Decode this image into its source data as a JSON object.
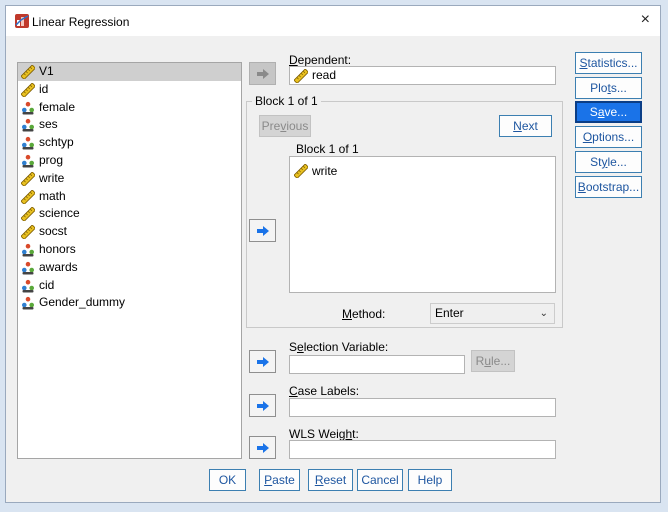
{
  "window": {
    "title": "Linear Regression",
    "close_label": "×"
  },
  "variables": [
    {
      "name": "V1",
      "type": "scale",
      "selected": true
    },
    {
      "name": "id",
      "type": "scale"
    },
    {
      "name": "female",
      "type": "nominal"
    },
    {
      "name": "ses",
      "type": "nominal"
    },
    {
      "name": "schtyp",
      "type": "nominal"
    },
    {
      "name": "prog",
      "type": "nominal"
    },
    {
      "name": "write",
      "type": "scale"
    },
    {
      "name": "math",
      "type": "scale"
    },
    {
      "name": "science",
      "type": "scale"
    },
    {
      "name": "socst",
      "type": "scale"
    },
    {
      "name": "honors",
      "type": "nominal"
    },
    {
      "name": "awards",
      "type": "nominal"
    },
    {
      "name": "cid",
      "type": "nominal"
    },
    {
      "name": "Gender_dummy",
      "type": "nominal"
    }
  ],
  "dependent": {
    "label_u": "D",
    "label_rest": "ependent:",
    "value": "read"
  },
  "block": {
    "legend": "Block 1 of 1",
    "header": "Block 1 of 1",
    "previous_pre": "Pre",
    "previous_u": "v",
    "previous_post": "ious",
    "next_u": "N",
    "next_rest": "ext",
    "independents": [
      "write"
    ],
    "method_u": "M",
    "method_rest": "ethod:",
    "method_value": "Enter"
  },
  "selection": {
    "pre": "S",
    "u": "e",
    "post": "lection Variable:",
    "value": "",
    "rule_pre": "R",
    "rule_u": "u",
    "rule_post": "le..."
  },
  "case_labels": {
    "u": "C",
    "post": "ase Labels:",
    "value": ""
  },
  "wls": {
    "pre": "WLS Weig",
    "u": "h",
    "post": "t:",
    "value": ""
  },
  "side_buttons": [
    {
      "pre": "",
      "u": "S",
      "post": "tatistics..."
    },
    {
      "pre": "Plo",
      "u": "t",
      "post": "s..."
    },
    {
      "pre": "S",
      "u": "a",
      "post": "ve..."
    },
    {
      "pre": "",
      "u": "O",
      "post": "ptions..."
    },
    {
      "pre": "St",
      "u": "y",
      "post": "le..."
    },
    {
      "pre": "",
      "u": "B",
      "post": "ootstrap..."
    }
  ],
  "bottom_buttons": {
    "ok": "OK",
    "paste_u": "P",
    "paste_rest": "aste",
    "reset_u": "R",
    "reset_rest": "eset",
    "cancel": "Cancel",
    "help": "Help"
  },
  "colors": {
    "accent": "#1a73e8",
    "link": "#1e56a0",
    "selection": "#cfcfcf",
    "scale_icon": "#d9a400",
    "nominal_icon_1": "#d94a2b",
    "nominal_icon_2": "#2f7fd0",
    "nominal_icon_3": "#5aa83a"
  },
  "icons": {
    "app": "regression-app-icon",
    "scale": "ruler-icon",
    "nominal": "nominal-people-icon",
    "arrow": "right-arrow-icon"
  }
}
